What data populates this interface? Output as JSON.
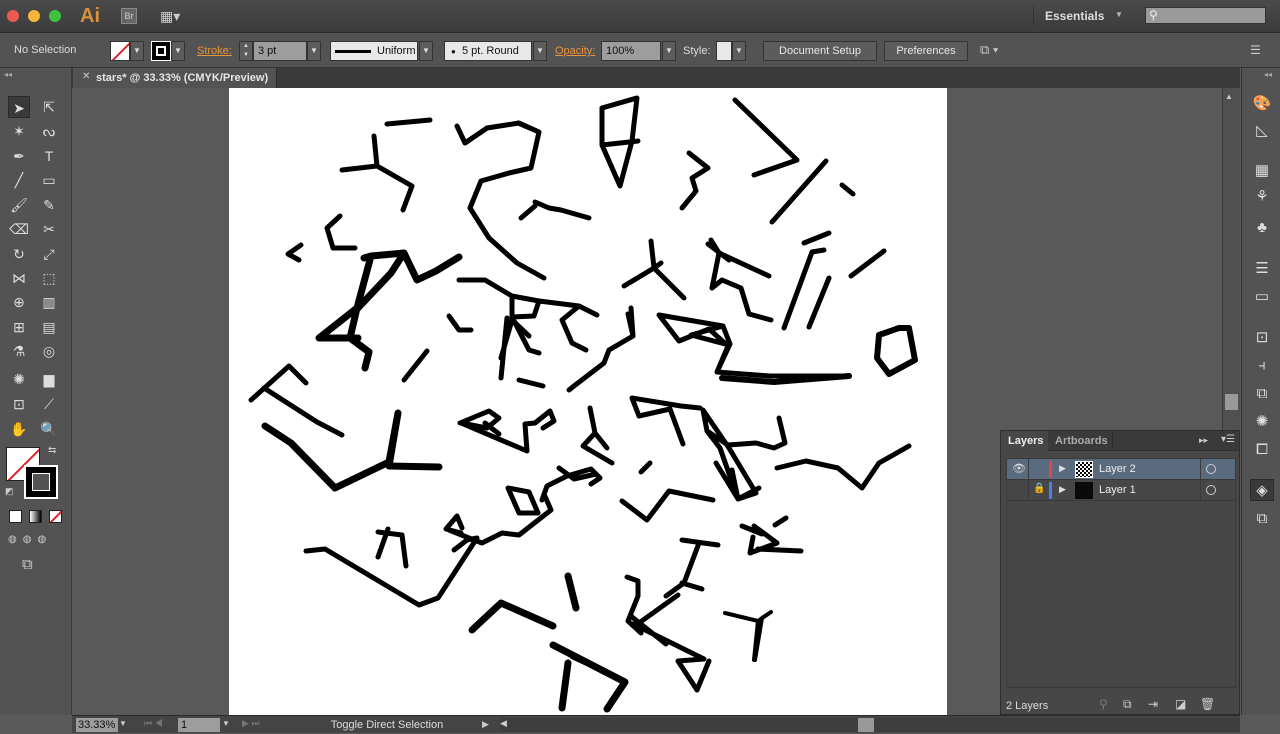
{
  "app": {
    "logo": "Ai",
    "bridge": "Br",
    "workspace": "Essentials",
    "search_placeholder": ""
  },
  "control": {
    "selection": "No Selection",
    "stroke_label": "Stroke:",
    "stroke_value": "3 pt",
    "profile": "Uniform",
    "brush": "5 pt. Round",
    "opacity_label": "Opacity:",
    "opacity_value": "100%",
    "style_label": "Style:",
    "document_setup": "Document Setup",
    "preferences": "Preferences"
  },
  "document": {
    "tab_title": "stars* @ 33.33% (CMYK/Preview)"
  },
  "layers_panel": {
    "tabs": [
      "Layers",
      "Artboards"
    ],
    "layers": [
      {
        "name": "Layer 2",
        "visible": true,
        "locked": false,
        "color": "#e8414a",
        "selected": true
      },
      {
        "name": "Layer 1",
        "visible": false,
        "locked": true,
        "color": "#4a7fe8",
        "selected": false
      }
    ],
    "count": "2 Layers"
  },
  "status": {
    "zoom": "33.33%",
    "artboard": "1",
    "tool_hint": "Toggle Direct Selection"
  },
  "colors": {
    "accent": "#e8923a"
  }
}
